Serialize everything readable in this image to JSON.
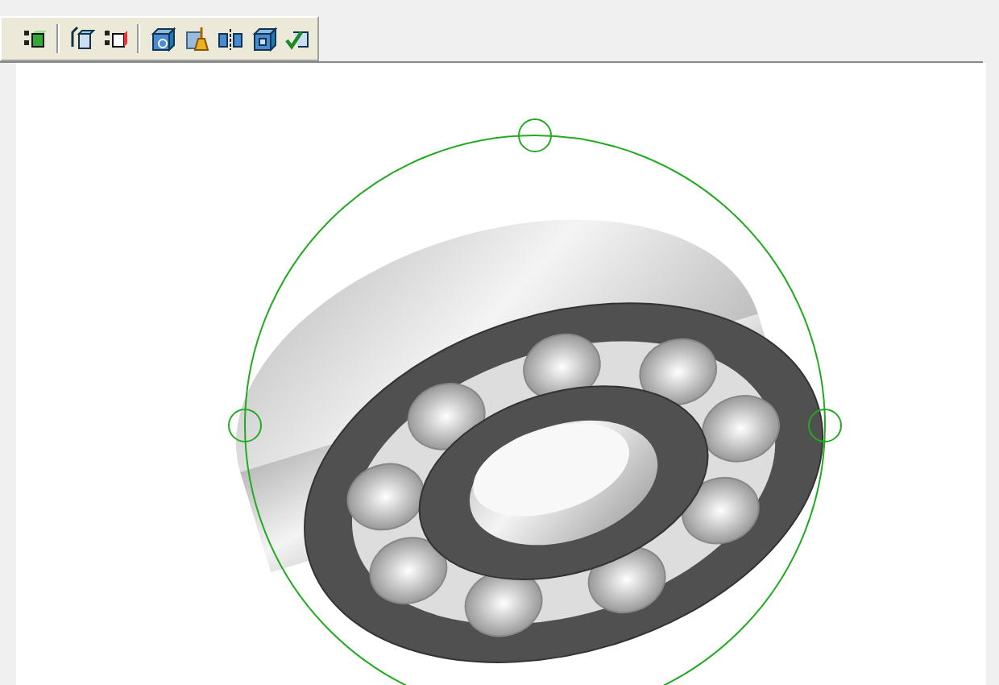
{
  "toolbar": {
    "groups": [
      {
        "items": [
          {
            "kind": "grid-box"
          }
        ]
      },
      {
        "items": [
          {
            "kind": "box-shade"
          },
          {
            "kind": "grid-box-red"
          }
        ]
      },
      {
        "items": [
          {
            "kind": "box-target"
          },
          {
            "kind": "broom"
          },
          {
            "kind": "split"
          },
          {
            "kind": "box-inner"
          },
          {
            "kind": "box-check"
          }
        ]
      }
    ]
  },
  "viewport": {
    "rotate_handle": true
  }
}
